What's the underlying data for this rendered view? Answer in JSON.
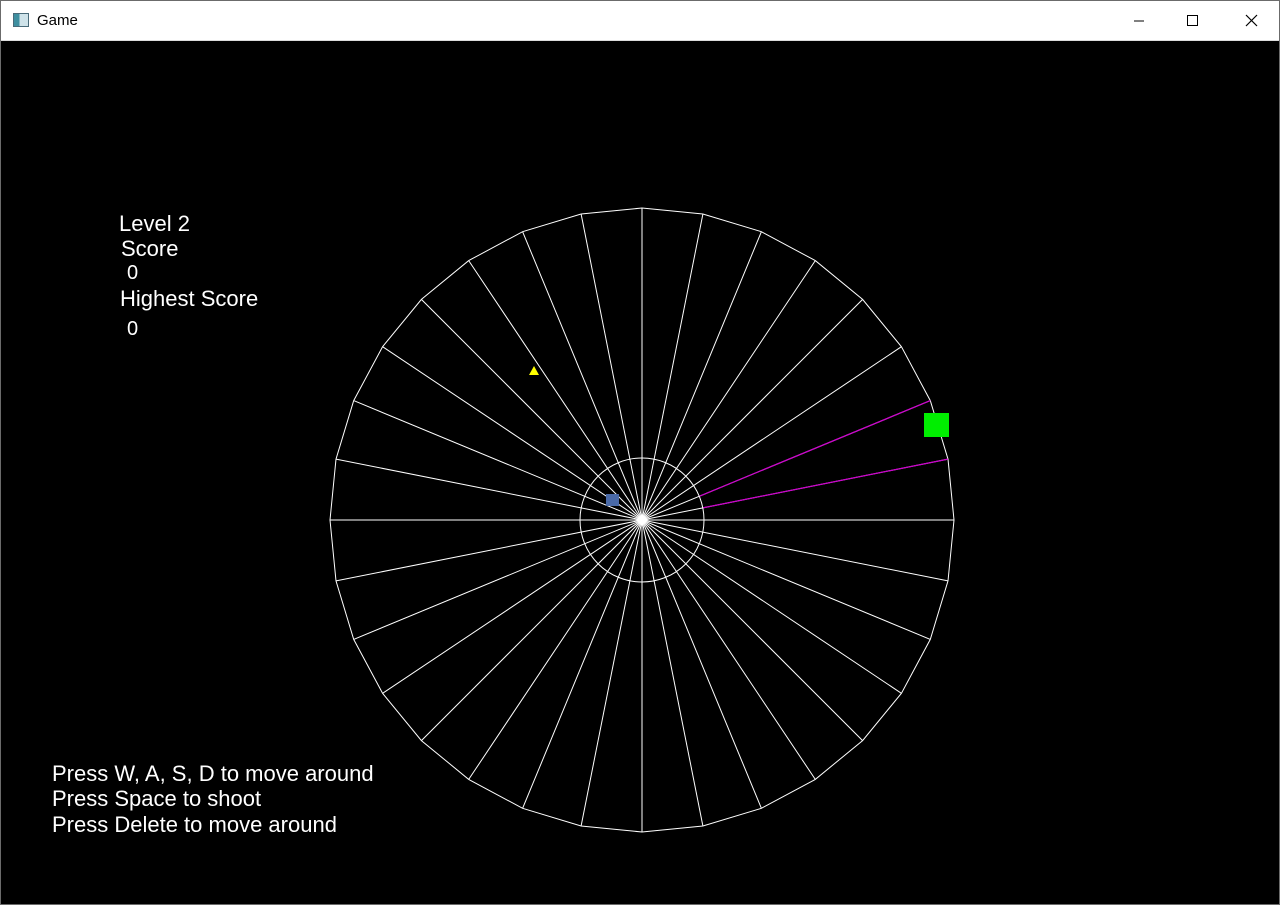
{
  "window": {
    "title": "Game",
    "icons": {
      "app": "app-window-icon",
      "minimize": "minimize-icon",
      "maximize": "maximize-icon",
      "close": "close-icon"
    }
  },
  "hud": {
    "level_label": "Level 2",
    "score_label": "Score",
    "score_value": "0",
    "highest_label": "Highest Score",
    "highest_value": "0"
  },
  "instructions": [
    "Press W, A, S, D to move around",
    "Press Space to shoot",
    "Press Delete to move around"
  ],
  "board": {
    "lanes": 32,
    "line_color": "#ffffff",
    "highlight_color": "#cc00cc",
    "highlighted_lane": "right side, just above the horizontal axis",
    "player": {
      "shape": "square",
      "color": "#00ee00"
    },
    "enemy": {
      "shape": "triangle",
      "color": "#ffff00"
    },
    "projectile": {
      "shape": "small square",
      "color": "#4a6aa8"
    }
  }
}
